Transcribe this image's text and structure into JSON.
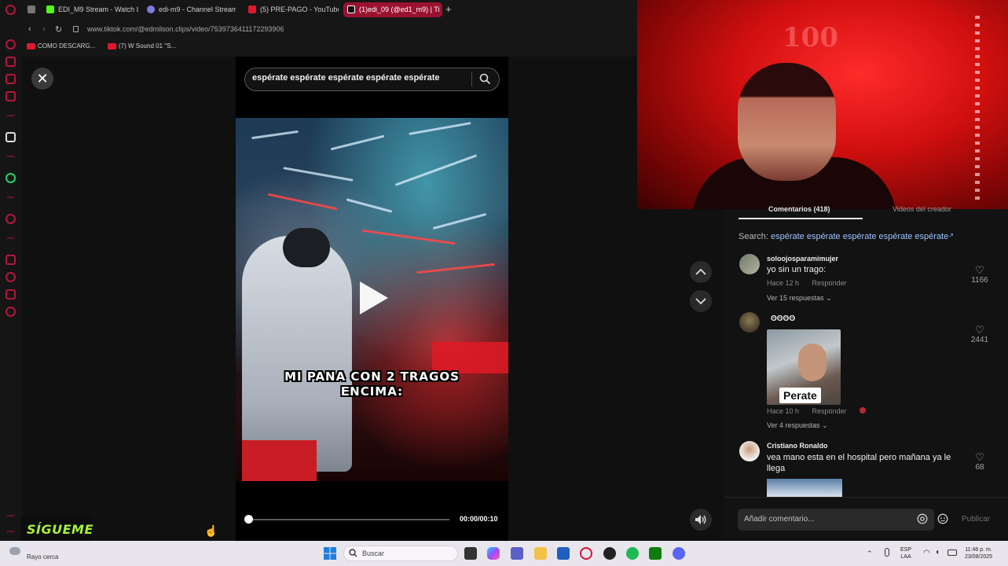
{
  "browser": {
    "tabs": [
      {
        "label": "EDI_M9 Stream - Watch L",
        "color": "#53fc18"
      },
      {
        "label": "edi-m9 - Channel Stream",
        "color": "#7c7ce0"
      },
      {
        "label": "(5) PRE-PAGO - YouTube",
        "color": "#e0182d"
      },
      {
        "label": "(1)edi_09 (@ed1_m9) | Ti",
        "color": "#ffffff"
      }
    ],
    "new_tab": "+",
    "url": "www.tiktok.com/@edmilson.clips/video/7539736411172293906",
    "bookmarks": [
      "COMO DESCARG...",
      "(7) W Sound 01 \"S..."
    ]
  },
  "video": {
    "close": "✕",
    "search_query": "espérate espérate espérate espérate espérate",
    "caption_line1": "MI PANA CON 2 TRAGOS",
    "caption_line2": "ENCIMA:",
    "time": "00:00/00:10",
    "progress": 0
  },
  "comments_panel": {
    "tab_comments": "Comentarios (418)",
    "tab_videos": "Videos del creador",
    "search_prefix": "Search: ",
    "search_query": "espérate espérate espérate espérate espérate",
    "comments": [
      {
        "user": "soloojosparamimujer",
        "text": "yo sin un trago:",
        "meta": "Hace 12 h",
        "reply": "Responder",
        "more": "Ver 15 respuestas",
        "likes": "1166"
      },
      {
        "user": "ʘʘʘʘ",
        "gif_label": "Perate",
        "meta": "Hace 10 h",
        "reply": "Responder",
        "more": "Ver 4 respuestas",
        "likes": "2441"
      },
      {
        "user": "Cristiano Ronaldo",
        "text": "vea mano esta en el hospital pero mañana ya le llega",
        "likes": "68"
      }
    ],
    "input_placeholder": "Añadir comentario...",
    "publish": "Publicar"
  },
  "overlay": {
    "follow": "SÍGUEME"
  },
  "taskbar": {
    "weather": "Rayo cerca",
    "search": "Buscar",
    "lang_top": "ESP",
    "lang_bottom": "LAA",
    "time": "11:46 p. m.",
    "date": "23/08/2025"
  },
  "colors": {
    "accent_red": "#b3173a",
    "link_blue": "#9cc2ff",
    "follow_green": "#a8f03c"
  }
}
